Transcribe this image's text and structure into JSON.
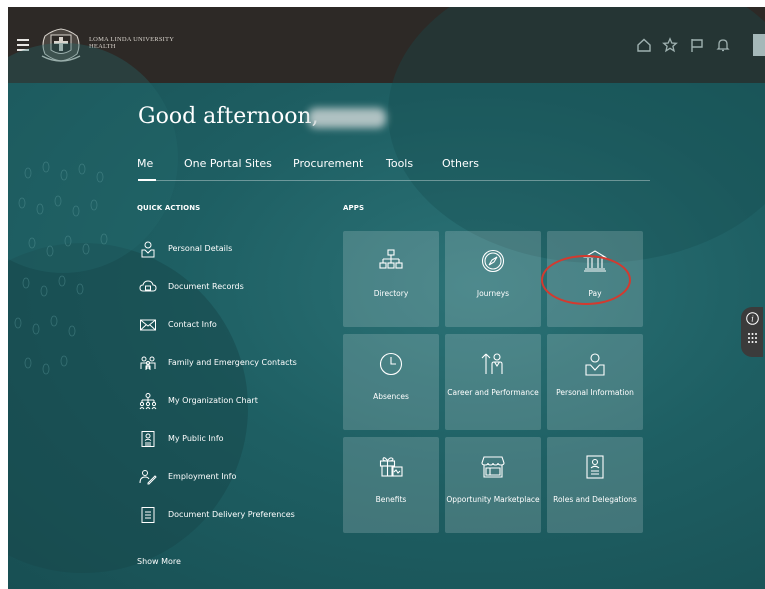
{
  "header": {
    "logo_text_line1": "LOMA LINDA UNIVERSITY",
    "logo_text_line2": "HEALTH",
    "icons": [
      "menu-icon",
      "home-icon",
      "star-icon",
      "flag-icon",
      "bell-icon"
    ]
  },
  "greeting": "Good afternoon,",
  "tabs": [
    "Me",
    "One Portal Sites",
    "Procurement",
    "Tools",
    "Others"
  ],
  "active_tab": "Me",
  "quick_actions": {
    "title": "QUICK ACTIONS",
    "items": [
      {
        "label": "Personal Details",
        "icon": "person-card-icon"
      },
      {
        "label": "Document Records",
        "icon": "cloud-document-icon"
      },
      {
        "label": "Contact Info",
        "icon": "envelope-icon"
      },
      {
        "label": "Family and Emergency Contacts",
        "icon": "family-icon"
      },
      {
        "label": "My Organization Chart",
        "icon": "org-chart-icon"
      },
      {
        "label": "My Public Info",
        "icon": "id-badge-icon"
      },
      {
        "label": "Employment Info",
        "icon": "person-edit-icon"
      },
      {
        "label": "Document Delivery Preferences",
        "icon": "document-list-icon"
      }
    ],
    "show_more": "Show More"
  },
  "apps": {
    "title": "APPS",
    "tiles": [
      {
        "label": "Directory",
        "icon": "org-chart-icon"
      },
      {
        "label": "Journeys",
        "icon": "compass-icon"
      },
      {
        "label": "Pay",
        "icon": "bank-icon"
      },
      {
        "label": "Absences",
        "icon": "clock-icon"
      },
      {
        "label": "Career and Performance",
        "icon": "career-icon"
      },
      {
        "label": "Personal Information",
        "icon": "person-card-icon"
      },
      {
        "label": "Benefits",
        "icon": "gift-icon"
      },
      {
        "label": "Opportunity Marketplace",
        "icon": "storefront-icon"
      },
      {
        "label": "Roles and Delegations",
        "icon": "id-badge-icon"
      }
    ]
  },
  "highlighted_tile": "Pay",
  "colors": {
    "header_bg": "#2d2926",
    "page_bg": "#1f5d61",
    "highlight": "#d33a2f"
  }
}
